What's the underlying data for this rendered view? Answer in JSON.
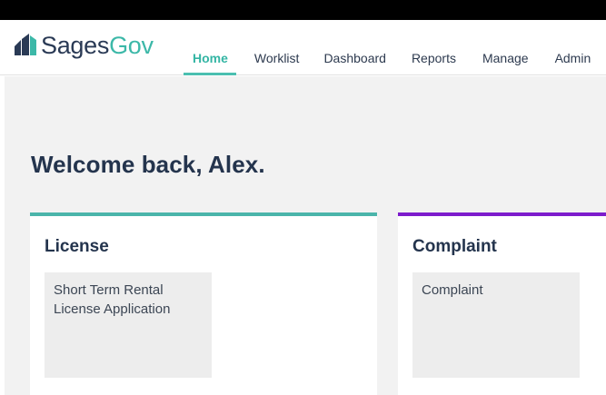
{
  "app": {
    "logo_part1": "Sages",
    "logo_part2": "Gov"
  },
  "nav": {
    "items": [
      {
        "label": "Home",
        "active": true
      },
      {
        "label": "Worklist"
      },
      {
        "label": "Dashboard"
      },
      {
        "label": "Reports"
      },
      {
        "label": "Manage"
      },
      {
        "label": "Admin"
      }
    ]
  },
  "main": {
    "welcome": "Welcome back, Alex.",
    "cards": [
      {
        "title": "License",
        "accent": "#4bb5aa",
        "tile": "Short Term Rental License Application"
      },
      {
        "title": "Complaint",
        "accent": "#7d1ccc",
        "tile": "Complaint"
      }
    ]
  },
  "colors": {
    "brand_navy": "#2a3a55",
    "brand_teal": "#3cb8a8",
    "background": "#f2f2f2"
  }
}
